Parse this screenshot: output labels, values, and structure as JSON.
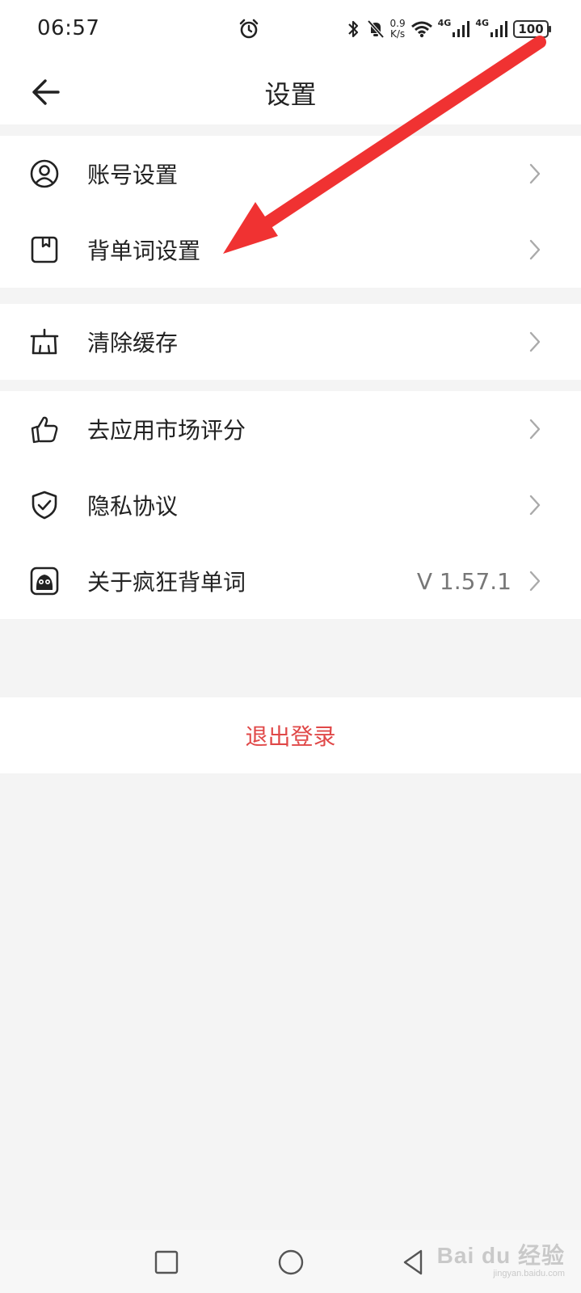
{
  "status_bar": {
    "time": "06:57",
    "speed_value": "0.9",
    "speed_unit": "K/s",
    "net1": "4G",
    "net2": "4G",
    "battery": "100"
  },
  "header": {
    "title": "设置"
  },
  "groups": {
    "account": [
      {
        "label": "账号设置",
        "icon": "user-circle-icon"
      },
      {
        "label": "背单词设置",
        "icon": "bookmark-book-icon"
      }
    ],
    "cache": [
      {
        "label": "清除缓存",
        "icon": "broom-icon"
      }
    ],
    "about": [
      {
        "label": "去应用市场评分",
        "icon": "thumbs-up-icon"
      },
      {
        "label": "隐私协议",
        "icon": "shield-check-icon"
      },
      {
        "label": "关于疯狂背单词",
        "icon": "app-logo-icon",
        "value": "V 1.57.1"
      }
    ]
  },
  "logout": {
    "label": "退出登录",
    "color": "#e04848"
  },
  "watermark": {
    "main": "Bai du 经验",
    "sub": "jingyan.baidu.com"
  },
  "colors": {
    "annotation_arrow": "#f03232",
    "background": "#f4f4f4"
  }
}
